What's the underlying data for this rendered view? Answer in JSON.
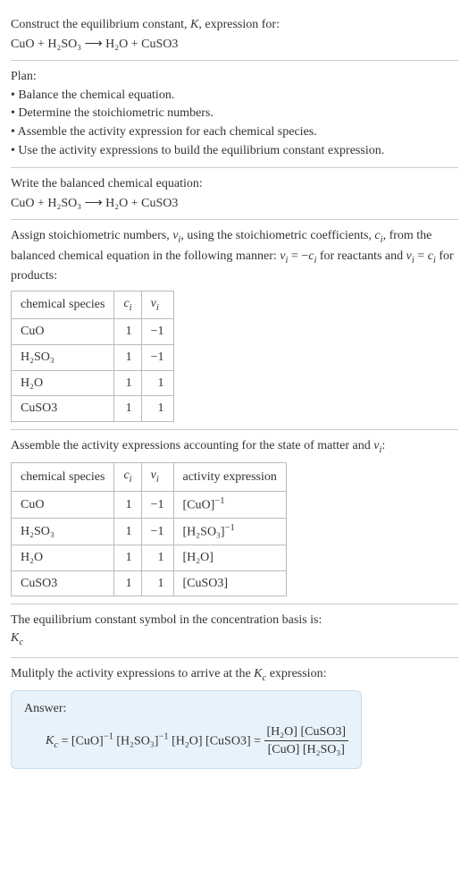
{
  "intro": {
    "line1": "Construct the equilibrium constant, K, expression for:",
    "equation": "CuO + H₂SO₃ ⟶ H₂O + CuSO3"
  },
  "plan": {
    "title": "Plan:",
    "steps": [
      "• Balance the chemical equation.",
      "• Determine the stoichiometric numbers.",
      "• Assemble the activity expression for each chemical species.",
      "• Use the activity expressions to build the equilibrium constant expression."
    ]
  },
  "balanced": {
    "title": "Write the balanced chemical equation:",
    "equation": "CuO + H₂SO₃ ⟶ H₂O + CuSO3"
  },
  "assign": {
    "text": "Assign stoichiometric numbers, νᵢ, using the stoichiometric coefficients, cᵢ, from the balanced chemical equation in the following manner: νᵢ = −cᵢ for reactants and νᵢ = cᵢ for products:",
    "headers": {
      "species": "chemical species",
      "ci": "cᵢ",
      "vi": "νᵢ"
    },
    "rows": [
      {
        "species": "CuO",
        "ci": "1",
        "vi": "−1"
      },
      {
        "species": "H₂SO₃",
        "ci": "1",
        "vi": "−1"
      },
      {
        "species": "H₂O",
        "ci": "1",
        "vi": "1"
      },
      {
        "species": "CuSO3",
        "ci": "1",
        "vi": "1"
      }
    ]
  },
  "activity": {
    "text": "Assemble the activity expressions accounting for the state of matter and νᵢ:",
    "headers": {
      "species": "chemical species",
      "ci": "cᵢ",
      "vi": "νᵢ",
      "act": "activity expression"
    },
    "rows": [
      {
        "species": "CuO",
        "ci": "1",
        "vi": "−1",
        "act": "[CuO]⁻¹"
      },
      {
        "species": "H₂SO₃",
        "ci": "1",
        "vi": "−1",
        "act": "[H₂SO₃]⁻¹"
      },
      {
        "species": "H₂O",
        "ci": "1",
        "vi": "1",
        "act": "[H₂O]"
      },
      {
        "species": "CuSO3",
        "ci": "1",
        "vi": "1",
        "act": "[CuSO3]"
      }
    ]
  },
  "symbol": {
    "text": "The equilibrium constant symbol in the concentration basis is:",
    "kc": "K𝑐"
  },
  "multiply": {
    "text": "Mulitply the activity expressions to arrive at the K𝑐 expression:"
  },
  "answer": {
    "label": "Answer:",
    "lhs": "K𝑐 = [CuO]⁻¹ [H₂SO₃]⁻¹ [H₂O] [CuSO3] = ",
    "frac_num": "[H₂O] [CuSO3]",
    "frac_den": "[CuO] [H₂SO₃]"
  },
  "chart_data": {
    "type": "table",
    "tables": [
      {
        "title": "Stoichiometric numbers",
        "columns": [
          "chemical species",
          "c_i",
          "ν_i"
        ],
        "rows": [
          [
            "CuO",
            1,
            -1
          ],
          [
            "H2SO3",
            1,
            -1
          ],
          [
            "H2O",
            1,
            1
          ],
          [
            "CuSO3",
            1,
            1
          ]
        ]
      },
      {
        "title": "Activity expressions",
        "columns": [
          "chemical species",
          "c_i",
          "ν_i",
          "activity expression"
        ],
        "rows": [
          [
            "CuO",
            1,
            -1,
            "[CuO]^-1"
          ],
          [
            "H2SO3",
            1,
            -1,
            "[H2SO3]^-1"
          ],
          [
            "H2O",
            1,
            1,
            "[H2O]"
          ],
          [
            "CuSO3",
            1,
            1,
            "[CuSO3]"
          ]
        ]
      }
    ]
  }
}
